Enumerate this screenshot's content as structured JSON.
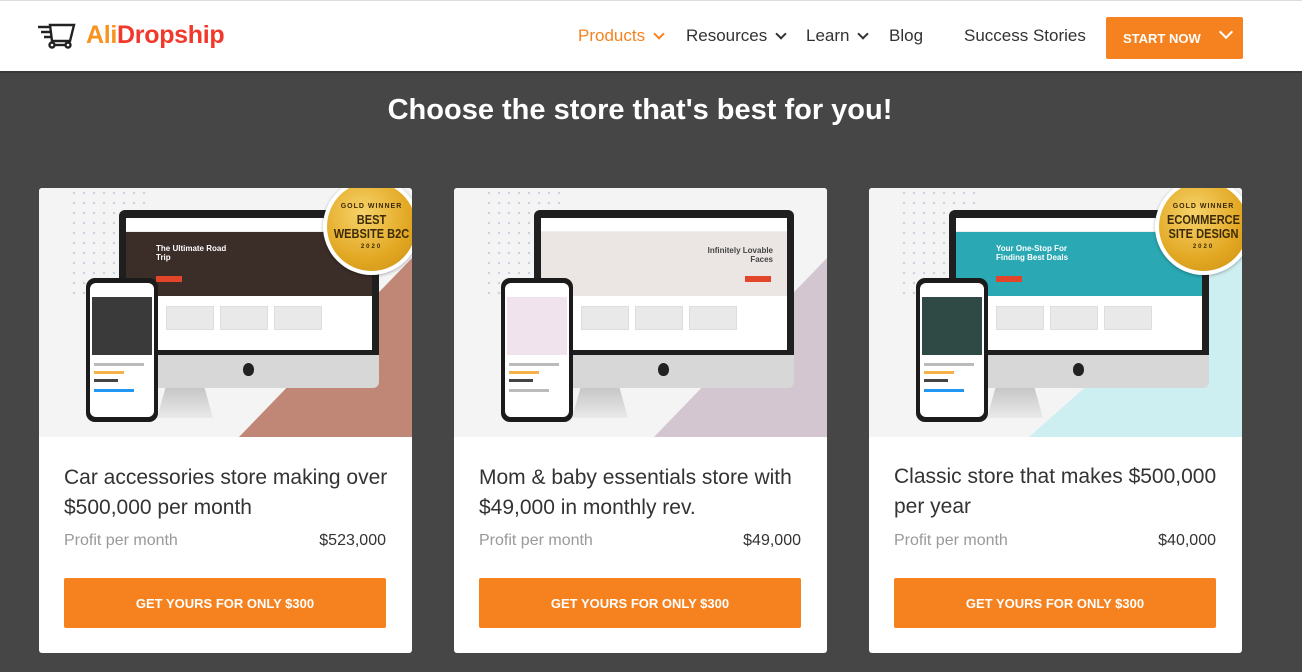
{
  "header": {
    "logo": {
      "part1": "Ali",
      "part2": "Dropship"
    },
    "nav": [
      {
        "label": "Products",
        "active": true,
        "dropdown": true
      },
      {
        "label": "Resources",
        "dropdown": true
      },
      {
        "label": "Learn",
        "dropdown": true
      },
      {
        "label": "Blog"
      },
      {
        "label": "Success Stories"
      }
    ],
    "cta": "START NOW"
  },
  "page_title": "Choose the store that's best for you!",
  "colors": {
    "accent": "#f5821f",
    "background": "#464646"
  },
  "cards": [
    {
      "title": "Car accessories store making over $500,000 per month",
      "profit_label": "Profit per month",
      "profit_value": "$523,000",
      "button": "GET YOURS FOR ONLY $300",
      "hero_text": "The Ultimate Road Trip",
      "badge": {
        "top": "GOLD WINNER",
        "main": "BEST WEBSITE B2C",
        "year": "2020"
      },
      "diag_color": "#c08676",
      "hero_color": "#3b2d28"
    },
    {
      "title": "Mom & baby essentials store with $49,000 in monthly rev.",
      "profit_label": "Profit per month",
      "profit_value": "$49,000",
      "button": "GET YOURS FOR ONLY $300",
      "hero_text": "Infinitely Lovable Faces",
      "diag_color": "#d3c6d1",
      "hero_color": "#ebe6e4"
    },
    {
      "title": "Classic store that makes $500,000 per year",
      "profit_label": "Profit per month",
      "profit_value": "$40,000",
      "button": "GET YOURS FOR ONLY $300",
      "hero_text": "Your One-Stop For Finding Best Deals",
      "badge": {
        "top": "GOLD WINNER",
        "main": "ECOMMERCE SITE DESIGN",
        "year": "2020"
      },
      "diag_color": "#cdeff2",
      "hero_color": "#2aa9b4"
    }
  ]
}
